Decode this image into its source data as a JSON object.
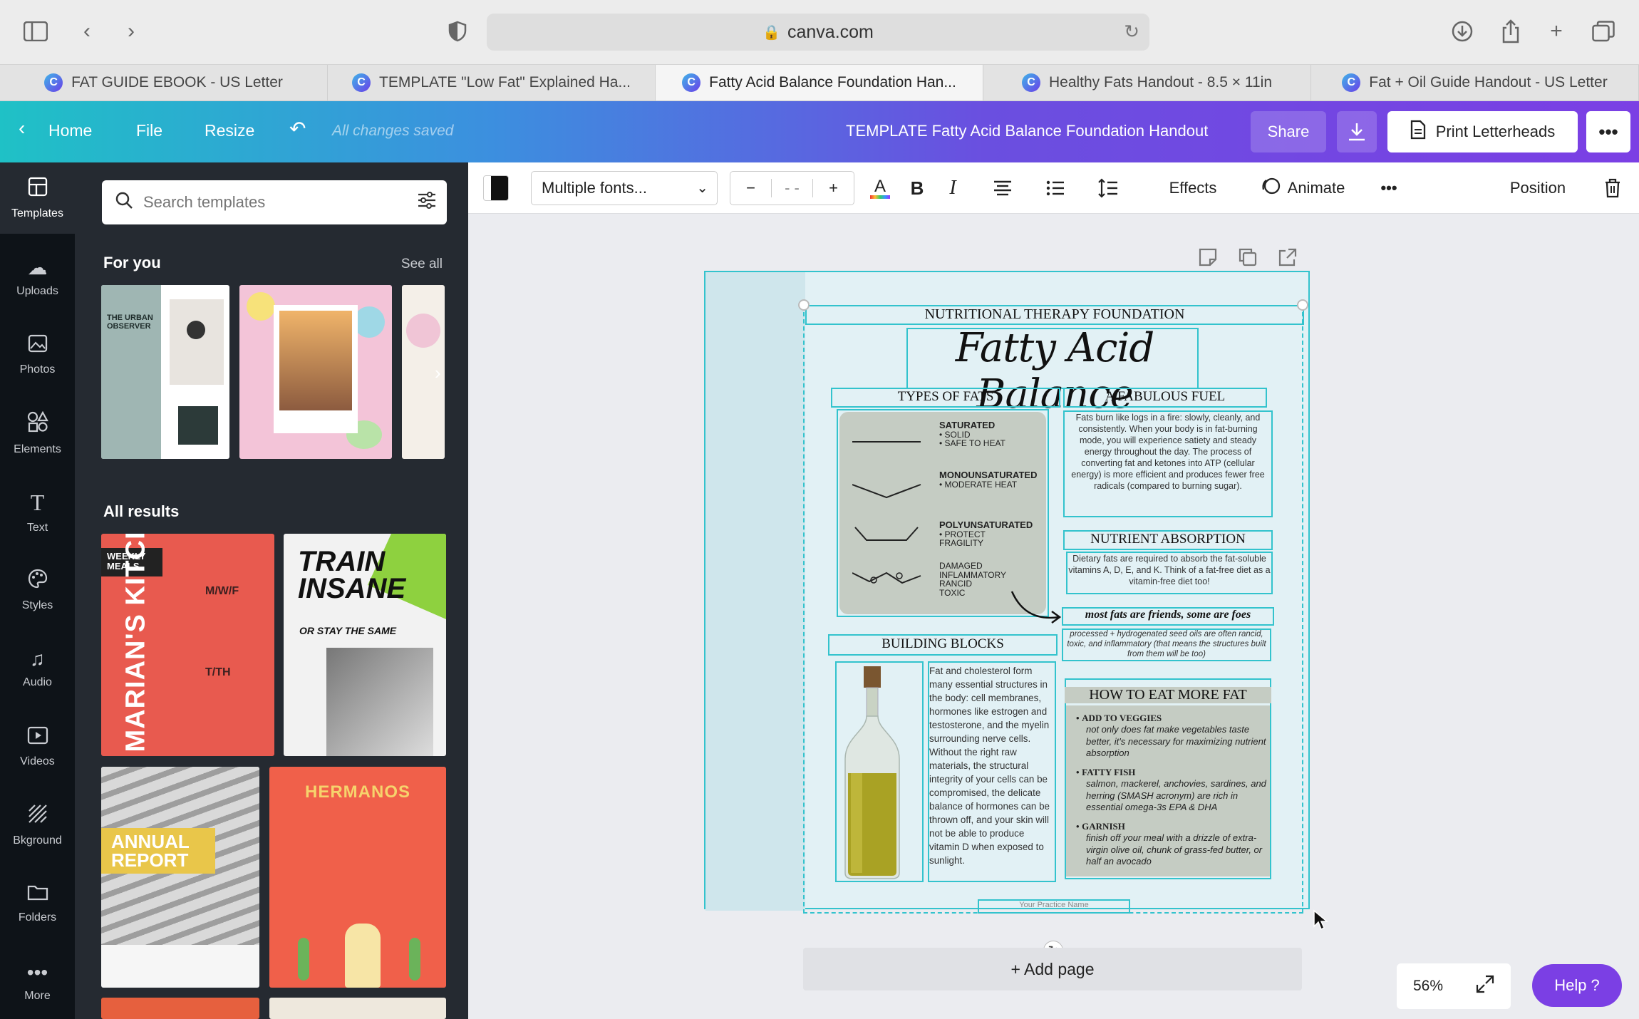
{
  "browser": {
    "url": "canva.com",
    "tabs": [
      {
        "label": "FAT GUIDE EBOOK - US Letter"
      },
      {
        "label": "TEMPLATE \"Low Fat\" Explained Ha..."
      },
      {
        "label": "Fatty Acid Balance Foundation Han..."
      },
      {
        "label": "Healthy Fats Handout - 8.5 × 11in"
      },
      {
        "label": "Fat + Oil Guide Handout - US Letter"
      }
    ],
    "tab_icon_letter": "C"
  },
  "header": {
    "home": "Home",
    "file": "File",
    "resize": "Resize",
    "saved_status": "All changes saved",
    "doc_title": "TEMPLATE Fatty Acid Balance Foundation Handout",
    "share": "Share",
    "print": "Print Letterheads"
  },
  "rail": {
    "items": [
      {
        "label": "Templates"
      },
      {
        "label": "Uploads"
      },
      {
        "label": "Photos"
      },
      {
        "label": "Elements"
      },
      {
        "label": "Text"
      },
      {
        "label": "Styles"
      },
      {
        "label": "Audio"
      },
      {
        "label": "Videos"
      },
      {
        "label": "Bkground"
      },
      {
        "label": "Folders"
      },
      {
        "label": "More"
      }
    ]
  },
  "panel": {
    "search_placeholder": "Search templates",
    "for_you": "For you",
    "see_all": "See all",
    "all_results": "All results",
    "thumbs": {
      "urban_observer": "THE URBAN OBSERVER",
      "weekly_meals": "WEEKLY MEALS",
      "marians_kitchen": "MARIAN'S KITCHEN",
      "mwf": "M/W/F",
      "tth": "T/TH",
      "train_insane": "TRAIN INSANE",
      "stay_same": "OR STAY THE SAME",
      "annual_report": "ANNUAL REPORT",
      "hermanos": "HERMANOS"
    }
  },
  "toolbar": {
    "font": "Multiple fonts...",
    "minus": "−",
    "size": "- -",
    "plus": "+",
    "effects": "Effects",
    "animate": "Animate",
    "position": "Position"
  },
  "handout": {
    "org": "NUTRITIONAL THERAPY FOUNDATION",
    "title": "Fatty Acid Balance",
    "types_heading": "TYPES OF FATS",
    "fuel_heading": "A FABULOUS FUEL",
    "fuel_text": "Fats burn like logs in a fire: slowly, cleanly, and consistently. When your body is in fat-burning mode, you will experience satiety and steady energy throughout the day. The process of converting fat and ketones into ATP (cellular energy) is more efficient and produces fewer free radicals (compared to burning sugar).",
    "fat_types": [
      {
        "name": "SATURATED",
        "notes": [
          "• SOLID",
          "• SAFE TO HEAT"
        ]
      },
      {
        "name": "MONOUNSATURATED",
        "notes": [
          "• MODERATE HEAT"
        ]
      },
      {
        "name": "POLYUNSATURATED",
        "notes": [
          "• PROTECT",
          "FRAGILITY"
        ]
      },
      {
        "name": "",
        "notes": [
          "DAMAGED",
          "INFLAMMATORY",
          "RANCID",
          "TOXIC"
        ]
      }
    ],
    "absorption_heading": "NUTRIENT ABSORPTION",
    "absorption_text": "Dietary fats are required to absorb the fat-soluble vitamins A, D, E, and K. Think of a fat-free diet as a vitamin-free diet too!",
    "friends_line": "most fats are friends, some are foes",
    "processed_text": "processed + hydrogenated seed oils are often rancid, toxic, and inflammatory (that means the structures built from them will be too)",
    "building_heading": "BUILDING BLOCKS",
    "building_text": "Fat and cholesterol form many essential structures in the body: cell membranes, hormones like estrogen and testosterone, and the myelin surrounding nerve cells. Without the right raw materials, the structural integrity of your cells can be compromised, the delicate balance of hormones can be thrown off, and your skin will not be able to produce vitamin D when exposed to sunlight.",
    "how_heading": "HOW TO EAT MORE FAT",
    "how_items": [
      {
        "title": "ADD TO VEGGIES",
        "text": "not only does fat make vegetables taste better, it's necessary for maximizing nutrient absorption"
      },
      {
        "title": "FATTY FISH",
        "text": "salmon, mackerel, anchovies, sardines, and herring (SMASH acronym) are rich in essential omega-3s EPA & DHA"
      },
      {
        "title": "GARNISH",
        "text": "finish off your meal with a drizzle of extra-virgin olive oil, chunk of grass-fed butter, or half an avocado"
      }
    ],
    "footer": "Your Practice Name"
  },
  "canvas": {
    "add_page": "+ Add page",
    "zoom": "56%",
    "help": "Help ?"
  },
  "colors": {
    "accent": "#7b3fe4",
    "selection": "#33c3cd",
    "panel": "#252a31",
    "rail": "#0e1318"
  }
}
